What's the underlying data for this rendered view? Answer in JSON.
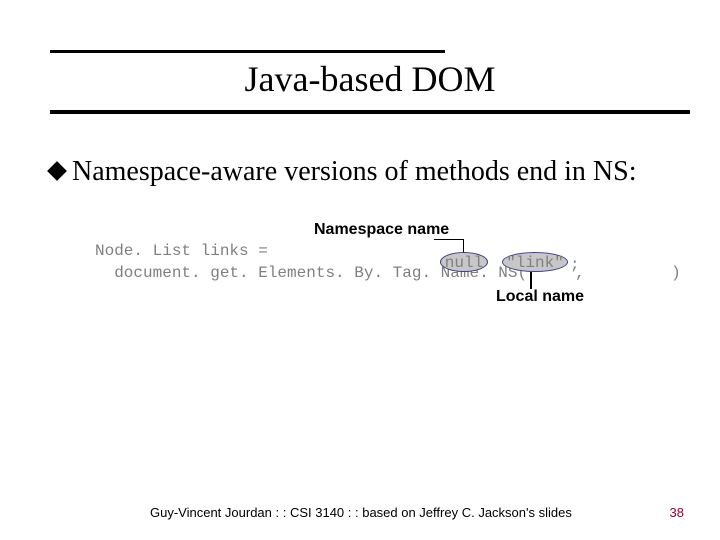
{
  "title": "Java-based DOM",
  "bullet": "Namespace-aware versions of methods end in NS:",
  "code": {
    "line1": "Node. List links =",
    "line2": "  document. get. Elements. By. Tag. Name. NS(     ,         )",
    "arg_null": "null",
    "arg_link": "\"link\"",
    "tail": ";"
  },
  "labels": {
    "namespace": "Namespace name",
    "local": "Local name"
  },
  "footer": {
    "left": "Guy-Vincent Jourdan : : CSI 3140 : : based on Jeffrey C. Jackson's slides",
    "page": "38"
  }
}
